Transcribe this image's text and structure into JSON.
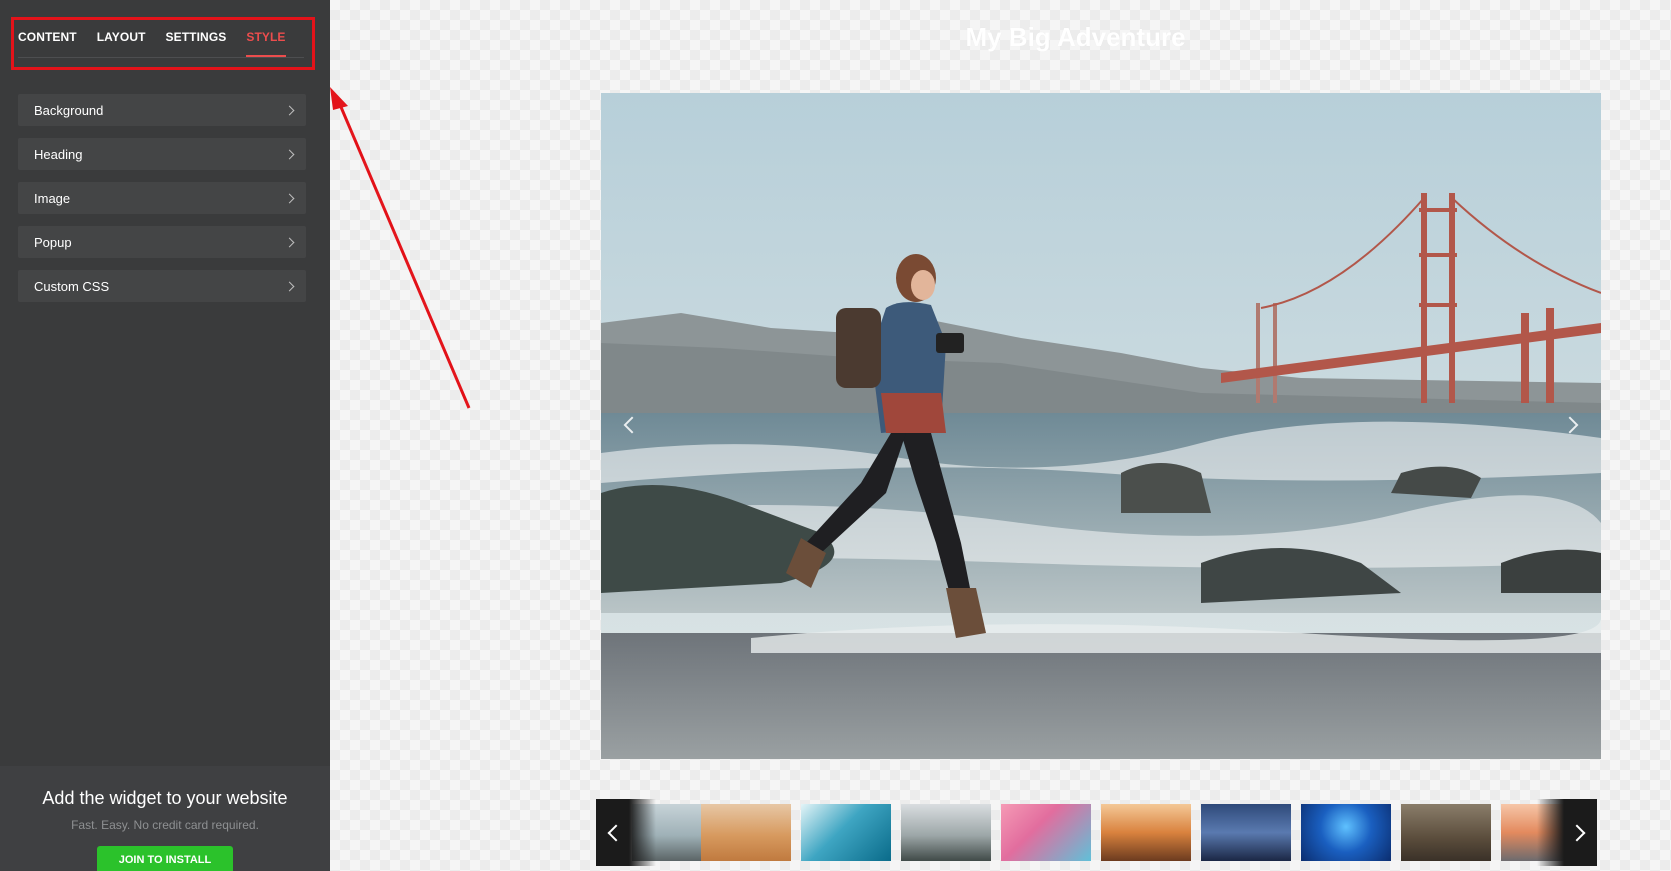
{
  "sidebar": {
    "tabs": [
      {
        "label": "CONTENT",
        "active": false
      },
      {
        "label": "LAYOUT",
        "active": false
      },
      {
        "label": "SETTINGS",
        "active": false
      },
      {
        "label": "STYLE",
        "active": true
      }
    ],
    "sections": [
      {
        "label": "Background",
        "icon": "chevron-right-icon"
      },
      {
        "label": "Heading",
        "icon": "chevron-right-icon"
      },
      {
        "label": "Image",
        "icon": "chevron-right-icon"
      },
      {
        "label": "Popup",
        "icon": "chevron-right-icon"
      },
      {
        "label": "Custom CSS",
        "icon": "chevron-right-icon"
      }
    ],
    "promo": {
      "title": "Add the widget to your website",
      "subtitle": "Fast. Easy. No credit card required.",
      "button_label": "JOIN TO INSTALL"
    }
  },
  "gallery": {
    "title": "My Big Adventure",
    "main_image": "woman-running-on-beach-golden-gate-bridge",
    "prev_icon": "chevron-left-icon",
    "next_icon": "chevron-right-icon",
    "thumbnails": [
      "beach-bridge-thumb",
      "desert-dunes-thumb",
      "ocean-wave-thumb",
      "motorcycle-thumb",
      "pink-clouds-thumb",
      "rock-arch-sunset-thumb",
      "lightning-beach-thumb",
      "underwater-blue-thumb",
      "bear-thumb",
      "sunset-rocks-thumb"
    ]
  },
  "colors": {
    "accent": "#ec4d4d",
    "sidebar_bg": "#3a3b3c",
    "section_bg": "#444546",
    "highlight_red": "#e3131a",
    "install_green": "#2bc22b"
  }
}
